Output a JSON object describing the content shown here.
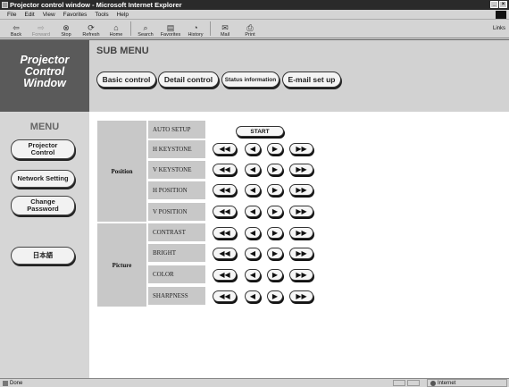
{
  "window": {
    "title": "Projector control window - Microsoft Internet Explorer"
  },
  "menubar": [
    "File",
    "Edit",
    "View",
    "Favorites",
    "Tools",
    "Help"
  ],
  "toolbar": {
    "buttons": [
      {
        "label": "Back",
        "icon": "back-arrow-icon"
      },
      {
        "label": "Forward",
        "icon": "forward-arrow-icon"
      },
      {
        "label": "Stop",
        "icon": "stop-icon"
      },
      {
        "label": "Refresh",
        "icon": "refresh-icon"
      },
      {
        "label": "Home",
        "icon": "home-icon"
      },
      {
        "label": "Search",
        "icon": "search-icon"
      },
      {
        "label": "Favorites",
        "icon": "favorites-icon"
      },
      {
        "label": "History",
        "icon": "history-icon"
      },
      {
        "label": "Mail",
        "icon": "mail-icon"
      },
      {
        "label": "Print",
        "icon": "print-icon"
      }
    ],
    "links": "Links"
  },
  "logo": {
    "line1": "Projector",
    "line2": "Control",
    "line3": "Window"
  },
  "submenu": {
    "title": "SUB MENU",
    "buttons": [
      "Basic control",
      "Detail control",
      "Status information",
      "E-mail set up"
    ]
  },
  "sidemenu": {
    "title": "MENU",
    "projector_control_1": "Projector",
    "projector_control_2": "Control",
    "network_setting": "Network Setting",
    "change_password_1": "Change",
    "change_password_2": "Password",
    "japanese": "日本語"
  },
  "control_table": {
    "group_position": "Position",
    "group_picture": "Picture",
    "auto_setup": "AUTO SETUP",
    "start": "START",
    "rows": [
      "H KEYSTONE",
      "V KEYSTONE",
      "H POSITION",
      "V POSITION",
      "CONTRAST",
      "BRIGHT",
      "COLOR",
      "SHARPNESS"
    ],
    "glyphs": {
      "fast_back": "◀◀",
      "back": "◀",
      "forward": "▶",
      "fast_forward": "▶▶"
    }
  },
  "statusbar": {
    "status": "Done",
    "zone": "Internet"
  }
}
